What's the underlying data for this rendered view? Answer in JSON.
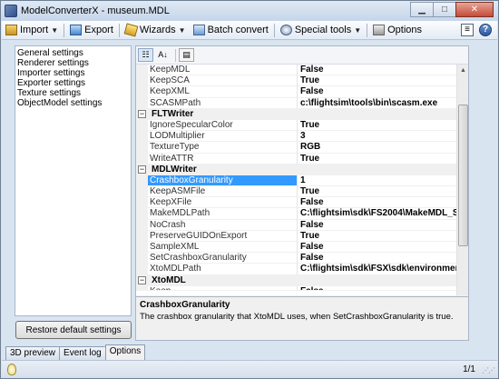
{
  "window": {
    "title": "ModelConverterX - museum.MDL"
  },
  "toolbar": {
    "import_label": "Import",
    "export_label": "Export",
    "wizards_label": "Wizards",
    "batch_label": "Batch convert",
    "special_label": "Special tools",
    "options_label": "Options"
  },
  "settings_list": [
    "General settings",
    "Renderer settings",
    "Importer settings",
    "Exporter settings",
    "Texture settings",
    "ObjectModel settings"
  ],
  "restore_button_label": "Restore default settings",
  "property_grid": {
    "top_rows": [
      {
        "name": "KeepMDL",
        "value": "False"
      },
      {
        "name": "KeepSCA",
        "value": "True"
      },
      {
        "name": "KeepXML",
        "value": "False"
      },
      {
        "name": "SCASMPath",
        "value": "c:\\flightsim\\tools\\bin\\scasm.exe"
      }
    ],
    "fltwriter": {
      "title": "FLTWriter",
      "rows": [
        {
          "name": "IgnoreSpecularColor",
          "value": "True"
        },
        {
          "name": "LODMultiplier",
          "value": "3"
        },
        {
          "name": "TextureType",
          "value": "RGB"
        },
        {
          "name": "WriteATTR",
          "value": "True"
        }
      ]
    },
    "mdlwriter": {
      "title": "MDLWriter",
      "rows": [
        {
          "name": "CrashboxGranularity",
          "value": "1"
        },
        {
          "name": "KeepASMFile",
          "value": "True"
        },
        {
          "name": "KeepXFile",
          "value": "False"
        },
        {
          "name": "MakeMDLPath",
          "value": "C:\\flightsim\\sdk\\FS2004\\MakeMDL_SD"
        },
        {
          "name": "NoCrash",
          "value": "False"
        },
        {
          "name": "PreserveGUIDOnExport",
          "value": "True"
        },
        {
          "name": "SampleXML",
          "value": "False"
        },
        {
          "name": "SetCrashboxGranularity",
          "value": "False"
        },
        {
          "name": "XtoMDLPath",
          "value": "C:\\flightsim\\sdk\\FSX\\sdk\\environment I"
        }
      ]
    },
    "xtomdl": {
      "title": "XtoMDL",
      "rows": [
        {
          "name": "Keep",
          "value": "False"
        }
      ]
    }
  },
  "help": {
    "title": "CrashboxGranularity",
    "description": "The crashbox granularity that XtoMDL uses, when SetCrashboxGranularity is true."
  },
  "tabs": [
    "3D preview",
    "Event log",
    "Options"
  ],
  "status": {
    "page": "1/1"
  }
}
